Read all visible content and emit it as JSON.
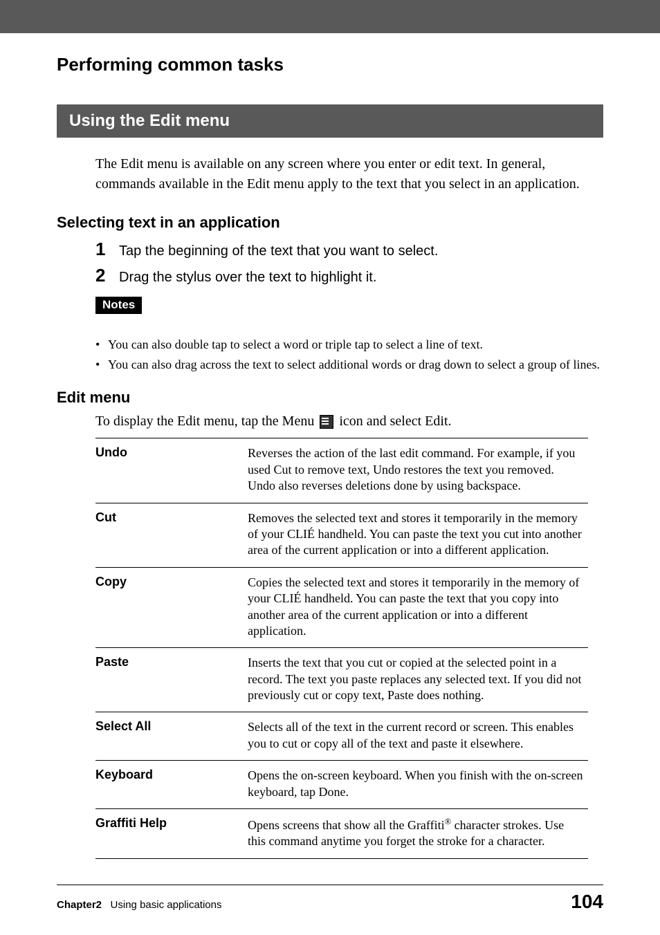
{
  "header": {
    "breadcrumb": "Performing common tasks",
    "section_title": "Using the Edit menu",
    "intro": "The Edit menu is available on any screen where you enter or edit text. In general, commands available in the Edit menu apply to the text that you select in an application."
  },
  "selecting": {
    "heading": "Selecting text in an application",
    "steps": [
      {
        "num": "1",
        "text": "Tap the beginning of the text that you want to select."
      },
      {
        "num": "2",
        "text": "Drag the stylus over the text to highlight it."
      }
    ],
    "notes_label": "Notes",
    "notes": [
      "You can also double tap to select a word or triple tap to select a line of text.",
      "You can also drag across the text to select additional words or drag down to select a group of lines."
    ]
  },
  "editmenu": {
    "heading": "Edit menu",
    "body_prefix": "To display the Edit menu, tap the Menu ",
    "body_suffix": " icon and select Edit.",
    "rows": [
      {
        "cmd": "Undo",
        "desc": "Reverses the action of the last edit command. For example, if you used Cut to remove text, Undo restores the text you removed. Undo also reverses deletions done by using backspace."
      },
      {
        "cmd": "Cut",
        "desc": "Removes the selected text and stores it temporarily in the memory of your CLIÉ handheld. You can paste the text you cut into another area of the current application or into a different application."
      },
      {
        "cmd": "Copy",
        "desc": "Copies the selected text and stores it temporarily in the memory of your CLIÉ handheld. You can paste the text that you copy into another area of the current application or into a different application."
      },
      {
        "cmd": "Paste",
        "desc": "Inserts the text that you cut or copied at the selected point in a record. The text you paste replaces any selected text. If you did not previously cut or copy text, Paste does nothing."
      },
      {
        "cmd": "Select All",
        "desc": "Selects all of the text in the current record or screen. This enables you to cut or copy all of the text and paste it elsewhere."
      },
      {
        "cmd": "Keyboard",
        "desc": "Opens the on-screen keyboard. When you finish with the on-screen keyboard, tap Done."
      },
      {
        "cmd": "Graffiti Help",
        "desc_prefix": "Opens screens that show all the Graffiti",
        "desc_sup": "®",
        "desc_suffix": " character strokes. Use this command anytime you forget the stroke for a character."
      }
    ]
  },
  "footer": {
    "chapter_label": "Chapter2",
    "chapter_title": "Using basic applications",
    "page_number": "104"
  }
}
